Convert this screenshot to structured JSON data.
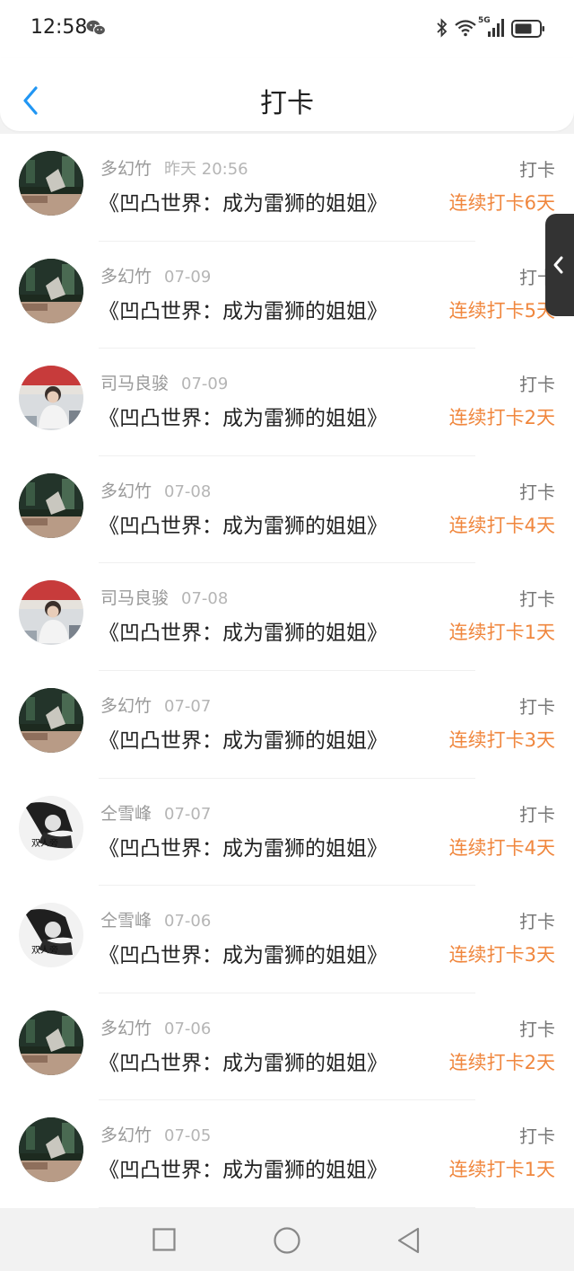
{
  "status_bar": {
    "time": "12:58",
    "network_label": "5G",
    "icons": [
      "wechat-icon",
      "bluetooth-icon",
      "wifi-icon",
      "signal-icon",
      "battery-icon"
    ]
  },
  "header": {
    "title": "打卡",
    "back_icon": "chevron-left-icon"
  },
  "colors": {
    "accent_back": "#2196f3",
    "streak_orange": "#f0873e",
    "text_primary": "#222222",
    "text_secondary": "#9a9a9a"
  },
  "items": [
    {
      "user": "多幻竹",
      "time": "昨天 20:56",
      "book": "《凹凸世界：成为雷狮的姐姐》",
      "action": "打卡",
      "streak": "连续打卡6天",
      "avatar": "avatar-type-a"
    },
    {
      "user": "多幻竹",
      "time": "07-09",
      "book": "《凹凸世界：成为雷狮的姐姐》",
      "action": "打卡",
      "streak": "连续打卡5天",
      "avatar": "avatar-type-a"
    },
    {
      "user": "司马良骏",
      "time": "07-09",
      "book": "《凹凸世界：成为雷狮的姐姐》",
      "action": "打卡",
      "streak": "连续打卡2天",
      "avatar": "avatar-type-b"
    },
    {
      "user": "多幻竹",
      "time": "07-08",
      "book": "《凹凸世界：成为雷狮的姐姐》",
      "action": "打卡",
      "streak": "连续打卡4天",
      "avatar": "avatar-type-a"
    },
    {
      "user": "司马良骏",
      "time": "07-08",
      "book": "《凹凸世界：成为雷狮的姐姐》",
      "action": "打卡",
      "streak": "连续打卡1天",
      "avatar": "avatar-type-b"
    },
    {
      "user": "多幻竹",
      "time": "07-07",
      "book": "《凹凸世界：成为雷狮的姐姐》",
      "action": "打卡",
      "streak": "连续打卡3天",
      "avatar": "avatar-type-a"
    },
    {
      "user": "仝雪峰",
      "time": "07-07",
      "book": "《凹凸世界：成为雷狮的姐姐》",
      "action": "打卡",
      "streak": "连续打卡4天",
      "avatar": "avatar-type-c"
    },
    {
      "user": "仝雪峰",
      "time": "07-06",
      "book": "《凹凸世界：成为雷狮的姐姐》",
      "action": "打卡",
      "streak": "连续打卡3天",
      "avatar": "avatar-type-c"
    },
    {
      "user": "多幻竹",
      "time": "07-06",
      "book": "《凹凸世界：成为雷狮的姐姐》",
      "action": "打卡",
      "streak": "连续打卡2天",
      "avatar": "avatar-type-a"
    },
    {
      "user": "多幻竹",
      "time": "07-05",
      "book": "《凹凸世界：成为雷狮的姐姐》",
      "action": "打卡",
      "streak": "连续打卡1天",
      "avatar": "avatar-type-a"
    }
  ],
  "side_tab": {
    "icon": "chevron-left-icon"
  },
  "nav_bar": {
    "icons": [
      "recents-square-icon",
      "home-circle-icon",
      "back-triangle-icon"
    ]
  }
}
